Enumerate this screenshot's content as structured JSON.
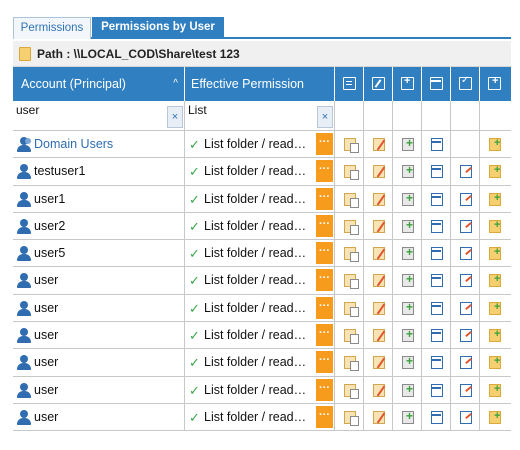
{
  "tabs": [
    {
      "label": "Permissions"
    },
    {
      "label": "Permissions by User"
    }
  ],
  "path": {
    "label": "Path : \\\\LOCAL_COD\\Share\\test 123"
  },
  "grid": {
    "header": {
      "account": "Account (Principal)",
      "sort_indicator": "^",
      "effective": "Effective Permission",
      "icon_columns": [
        "read-icon",
        "write-icon",
        "create-files-icon",
        "list-window-icon",
        "modify-icon",
        "create-folder-icon"
      ]
    },
    "filter": {
      "account_value": "user",
      "effective_value": "List",
      "clear_glyph": "×"
    },
    "rows": [
      {
        "account": "Domain Users",
        "type": "group",
        "effective": "List folder / read…",
        "icons": [
          "read",
          "write",
          "create",
          "window",
          "",
          "fold"
        ]
      },
      {
        "account": "testuser1",
        "type": "user",
        "effective": "List folder / read…",
        "icons": [
          "read",
          "write",
          "create",
          "window",
          "mod",
          "fold"
        ]
      },
      {
        "account": "user1",
        "type": "user",
        "effective": "List folder / read…",
        "icons": [
          "read",
          "write",
          "create",
          "window",
          "mod",
          "fold"
        ]
      },
      {
        "account": "user2",
        "type": "user",
        "effective": "List folder / read…",
        "icons": [
          "read",
          "write",
          "create",
          "window",
          "mod",
          "fold"
        ]
      },
      {
        "account": "user5",
        "type": "user",
        "effective": "List folder / read…",
        "icons": [
          "read",
          "write",
          "create",
          "window",
          "mod",
          "fold"
        ]
      },
      {
        "account": "user",
        "type": "user",
        "effective": "List folder / read…",
        "icons": [
          "read",
          "write",
          "create",
          "window",
          "mod",
          "fold"
        ]
      },
      {
        "account": "user",
        "type": "user",
        "effective": "List folder / read…",
        "icons": [
          "read",
          "write",
          "create",
          "window",
          "mod",
          "fold"
        ]
      },
      {
        "account": "user",
        "type": "user",
        "effective": "List folder / read…",
        "icons": [
          "read",
          "write",
          "create",
          "window",
          "mod",
          "fold"
        ]
      },
      {
        "account": "user",
        "type": "user",
        "effective": "List folder / read…",
        "icons": [
          "read",
          "write",
          "create",
          "window",
          "mod",
          "fold"
        ]
      },
      {
        "account": "user",
        "type": "user",
        "effective": "List folder / read…",
        "icons": [
          "read",
          "write",
          "create",
          "window",
          "mod",
          "fold"
        ]
      },
      {
        "account": "user",
        "type": "user",
        "effective": "List folder / read…",
        "icons": [
          "read",
          "write",
          "create",
          "window",
          "mod",
          "fold"
        ]
      }
    ],
    "more_glyph": "···",
    "check_glyph": "✓"
  },
  "colors": {
    "accent": "#2f7fc1",
    "more_button": "#f79b1d",
    "check": "#3aa54a"
  }
}
